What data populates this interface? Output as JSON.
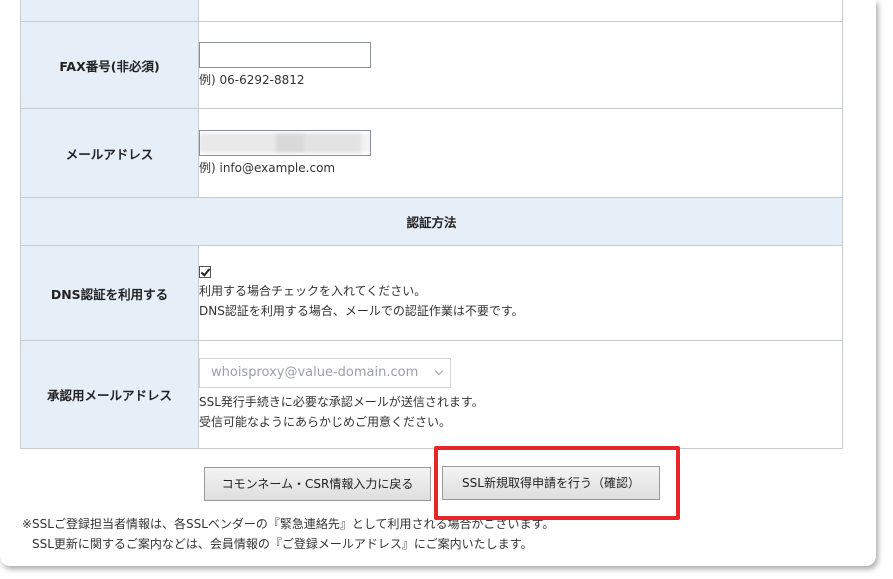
{
  "form": {
    "fax": {
      "label": "FAX番号(非必須)",
      "value": "",
      "example": "例) 06-6292-8812"
    },
    "email": {
      "label": "メールアドレス",
      "example": "例) info@example.com"
    },
    "auth_section": {
      "title": "認証方法"
    },
    "dns": {
      "label": "DNS認証を利用する",
      "checked": true,
      "help1": "利用する場合チェックを入れてください。",
      "help2": "DNS認証を利用する場合、メールでの認証作業は不要です。"
    },
    "approval_email": {
      "label": "承認用メールアドレス",
      "selected": "whoisproxy@value-domain.com",
      "help1": "SSL発行手続きに必要な承認メールが送信されます。",
      "help2": "受信可能なようにあらかじめご用意ください。"
    }
  },
  "buttons": {
    "back_label": "コモンネーム・CSR情報入力に戻る",
    "confirm_label": "SSL新規取得申請を行う（確認）"
  },
  "notes": {
    "line1": "※SSLご登録担当者情報は、各SSLベンダーの『緊急連絡先』として利用される場合がございます。",
    "line2": "SSL更新に関するご案内などは、会員情報の『ご登録メールアドレス』にご案内いたします。"
  },
  "colors": {
    "label_bg": "#e6eef8",
    "highlight": "#e8262a",
    "border": "#c8ccd2"
  },
  "icons": {
    "checkbox": "checkmark-icon",
    "select": "chevron-down-icon"
  }
}
